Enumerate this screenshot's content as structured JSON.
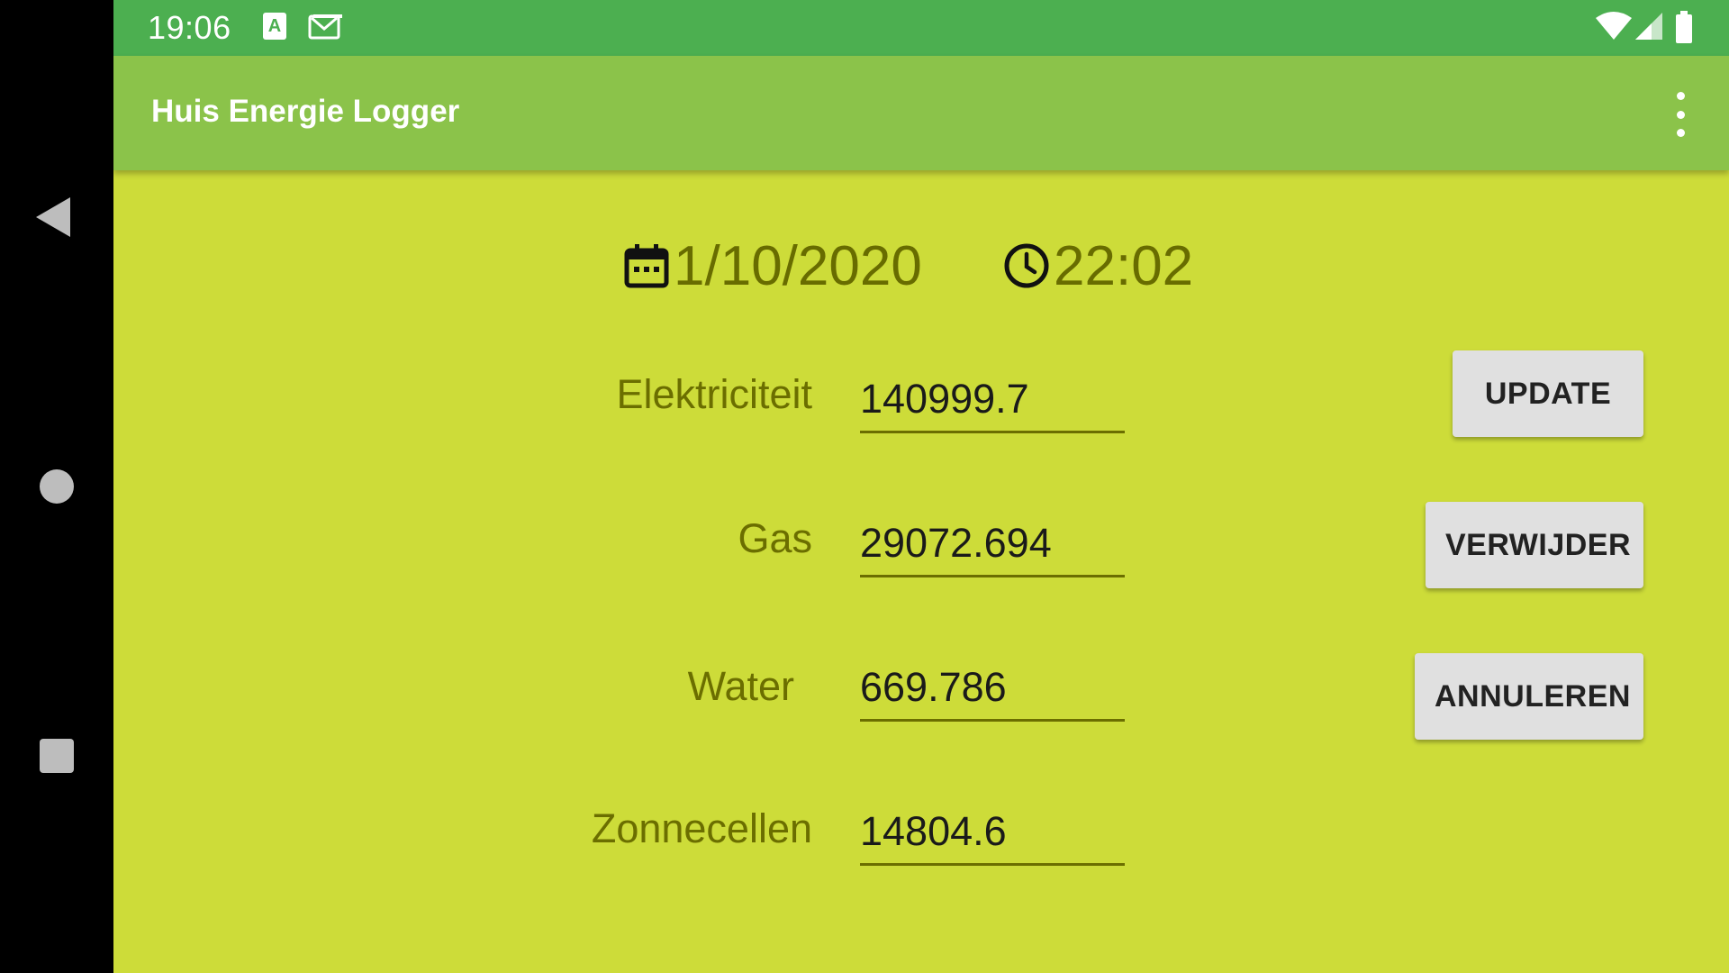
{
  "status_bar": {
    "time": "19:06",
    "icons": [
      "text-a-icon",
      "mail-icon",
      "wifi-icon",
      "signal-icon",
      "battery-icon"
    ]
  },
  "app_bar": {
    "title": "Huis Energie Logger",
    "menu_icon": "overflow-menu-icon"
  },
  "datetime": {
    "date": "1/10/2020",
    "time": "22:02",
    "date_icon": "calendar-icon",
    "time_icon": "clock-icon"
  },
  "fields": {
    "electricity": {
      "label": "Elektriciteit",
      "value": "140999.7"
    },
    "gas": {
      "label": "Gas",
      "value": "29072.694"
    },
    "water": {
      "label": "Water",
      "value": "669.786"
    },
    "solar": {
      "label": "Zonnecellen",
      "value": "14804.6"
    }
  },
  "buttons": {
    "update": "UPDATE",
    "delete": "VERWIJDER",
    "cancel": "ANNULEREN"
  },
  "colors": {
    "status_bar": "#4caf50",
    "app_bar": "#8bc34a",
    "background": "#cddc39",
    "label_text": "#6b6e00",
    "button_bg": "#e0e0e0"
  }
}
